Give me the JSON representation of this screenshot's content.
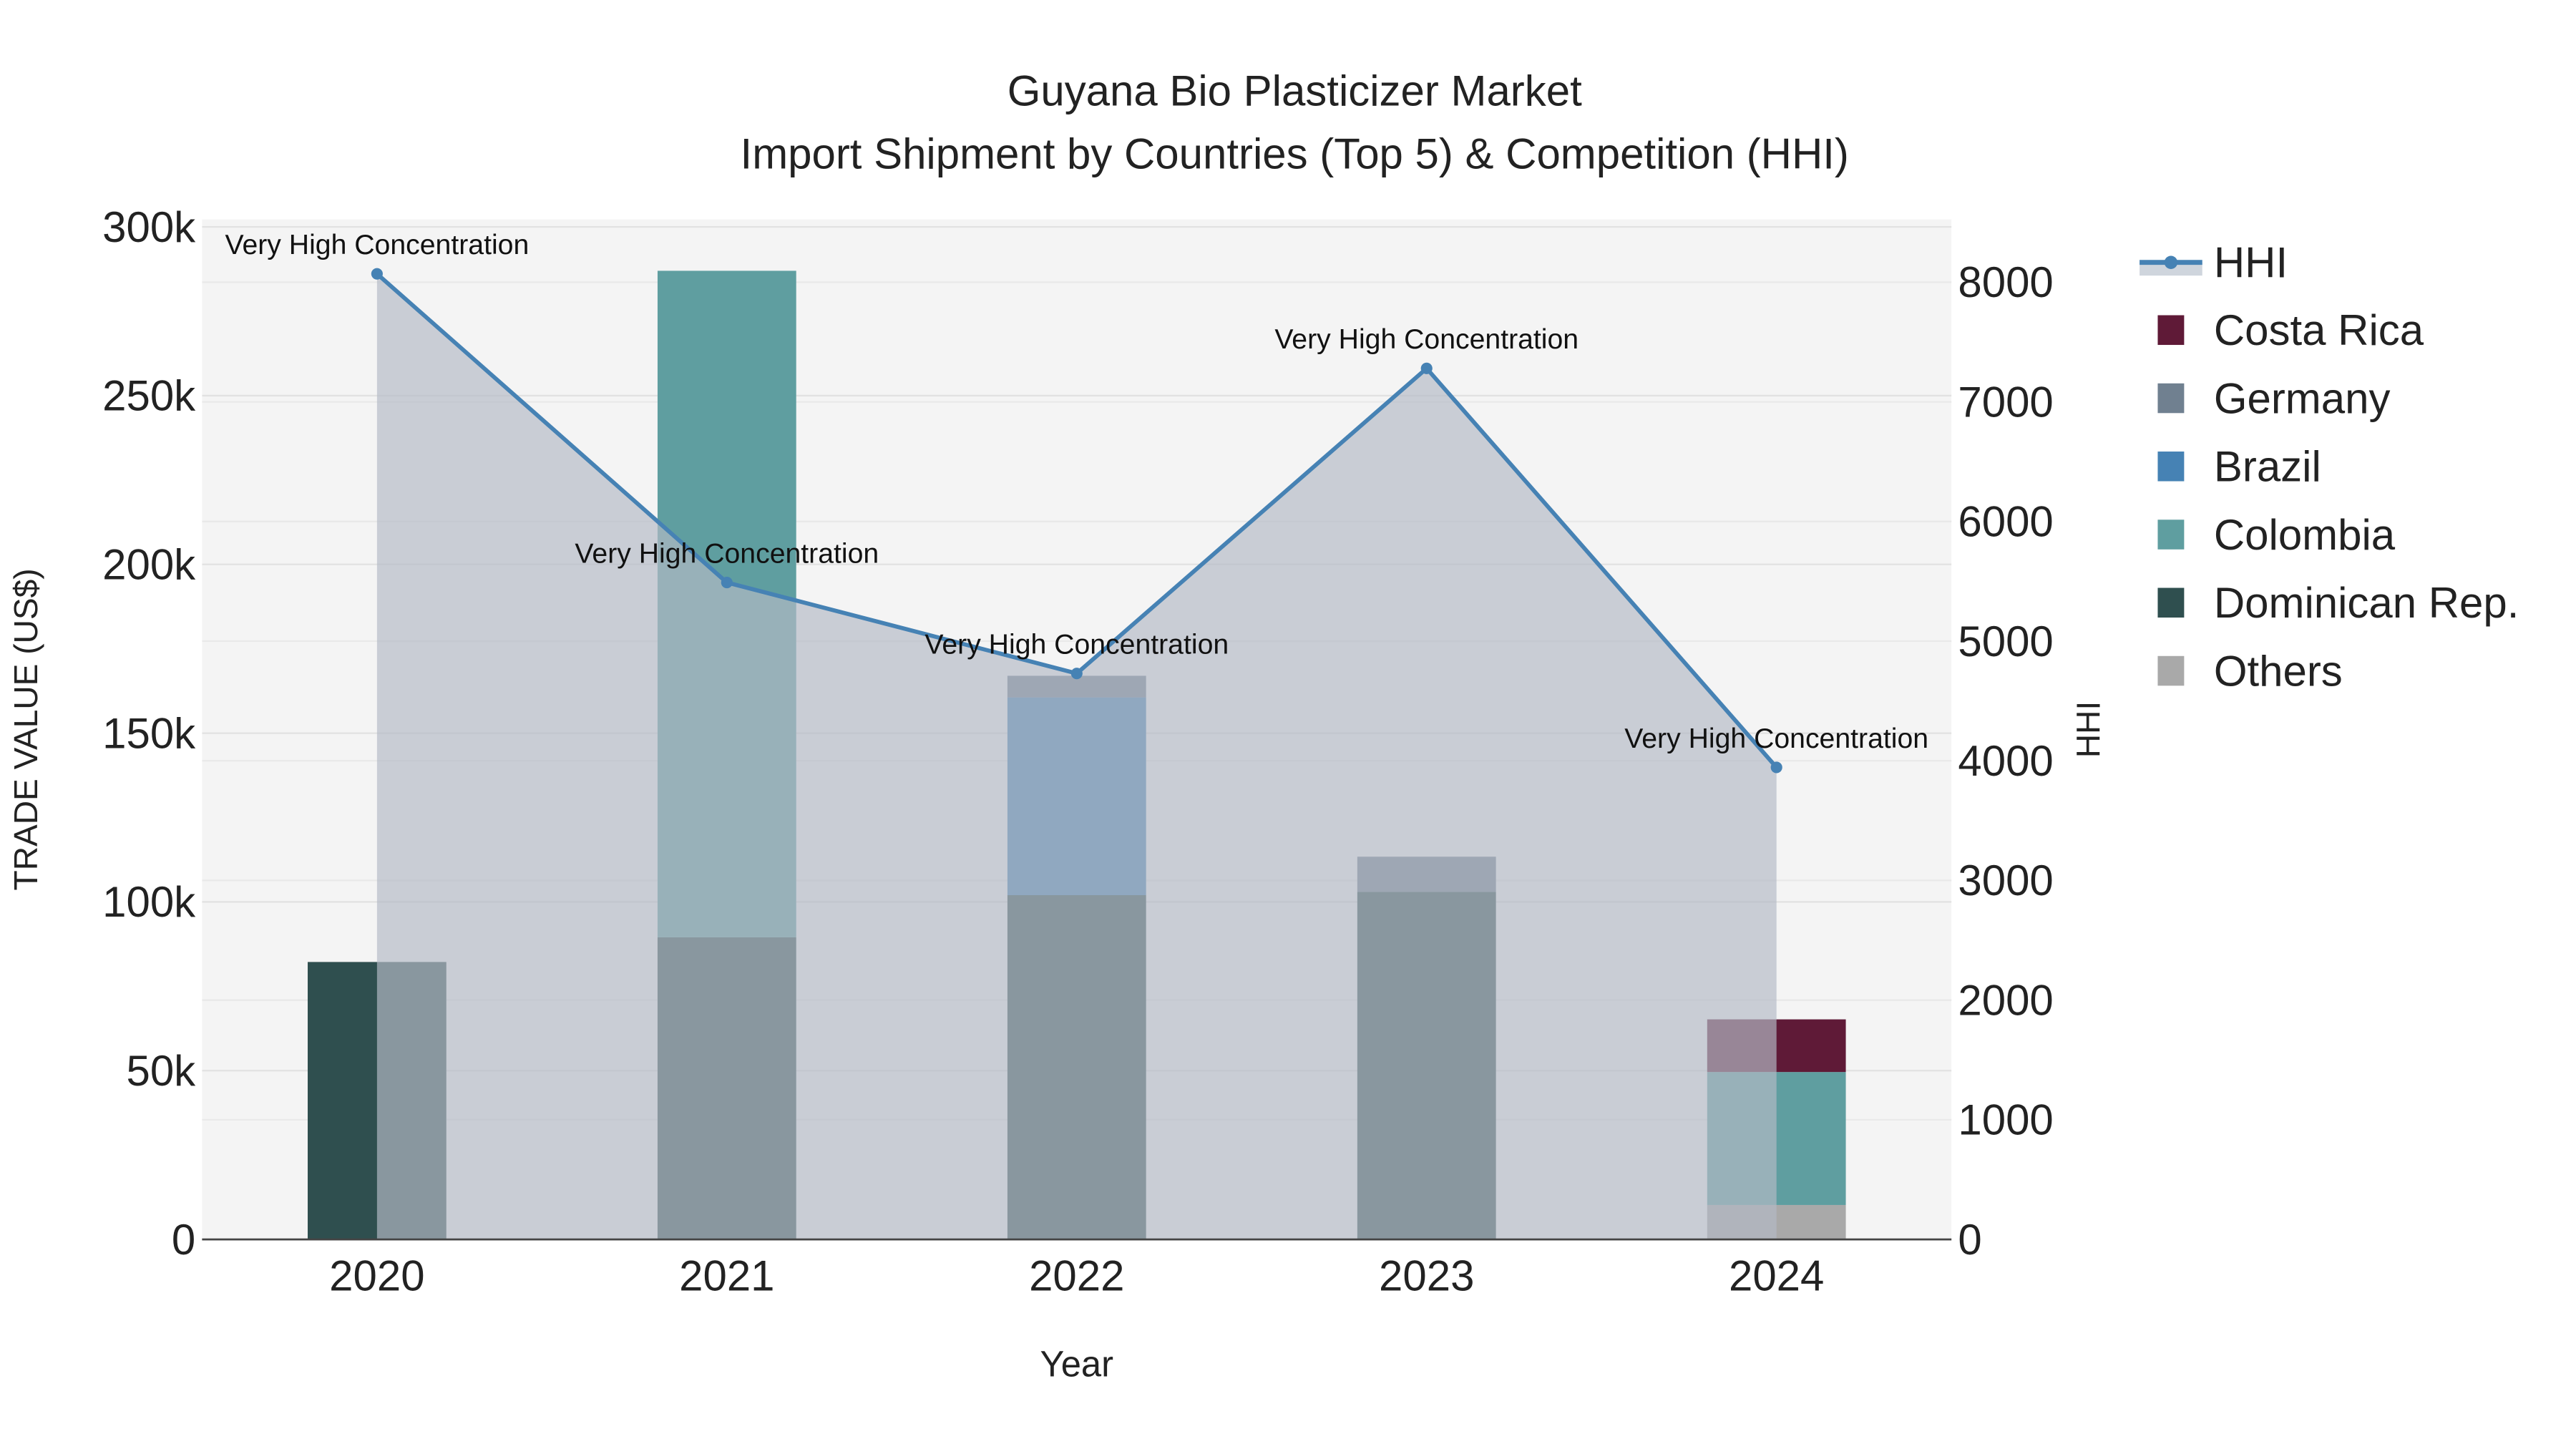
{
  "chart_data": {
    "type": "bar",
    "title": "Guyana Bio Plasticizer Market",
    "subtitle": "Import Shipment by Countries (Top 5) & Competition (HHI)",
    "xlabel": "Year",
    "ylabel": "TRADE VALUE (US$)",
    "y2label": "HHI",
    "categories": [
      "2020",
      "2021",
      "2022",
      "2023",
      "2024"
    ],
    "ylim": [
      0,
      300000
    ],
    "y2lim": [
      0,
      8500
    ],
    "yticks": [
      {
        "v": 0,
        "label": "0"
      },
      {
        "v": 50000,
        "label": "50k"
      },
      {
        "v": 100000,
        "label": "100k"
      },
      {
        "v": 150000,
        "label": "150k"
      },
      {
        "v": 200000,
        "label": "200k"
      },
      {
        "v": 250000,
        "label": "250k"
      },
      {
        "v": 300000,
        "label": "300k"
      }
    ],
    "y2ticks": [
      {
        "v": 0,
        "label": "0"
      },
      {
        "v": 1000,
        "label": "1000"
      },
      {
        "v": 2000,
        "label": "2000"
      },
      {
        "v": 3000,
        "label": "3000"
      },
      {
        "v": 4000,
        "label": "4000"
      },
      {
        "v": 5000,
        "label": "5000"
      },
      {
        "v": 6000,
        "label": "6000"
      },
      {
        "v": 7000,
        "label": "7000"
      },
      {
        "v": 8000,
        "label": "8000"
      }
    ],
    "grid": true,
    "legend_position": "right",
    "stack_order": [
      "Others",
      "Dominican Rep.",
      "Colombia",
      "Brazil",
      "Germany",
      "Costa Rica"
    ],
    "series": [
      {
        "name": "Costa Rica",
        "color": "#5f1a37",
        "values": [
          0,
          0,
          0,
          0,
          15600
        ]
      },
      {
        "name": "Germany",
        "color": "#708090",
        "values": [
          0,
          0,
          6400,
          10400,
          0
        ]
      },
      {
        "name": "Brazil",
        "color": "#4682b4",
        "values": [
          0,
          0,
          58600,
          0,
          0
        ]
      },
      {
        "name": "Colombia",
        "color": "#5f9ea0",
        "values": [
          0,
          197500,
          0,
          0,
          39400
        ]
      },
      {
        "name": "Dominican Rep.",
        "color": "#2f4f4f",
        "values": [
          82200,
          89500,
          102000,
          103000,
          0
        ]
      },
      {
        "name": "Others",
        "color": "#a9a9a9",
        "values": [
          0,
          0,
          0,
          0,
          10200
        ]
      }
    ],
    "hhi": {
      "name": "HHI",
      "color": "#4682b4",
      "values": [
        8070,
        5490,
        4730,
        7280,
        3945
      ],
      "annotations": [
        "Very High Concentration",
        "Very High Concentration",
        "Very High Concentration",
        "Very High Concentration",
        "Very High Concentration"
      ]
    }
  }
}
